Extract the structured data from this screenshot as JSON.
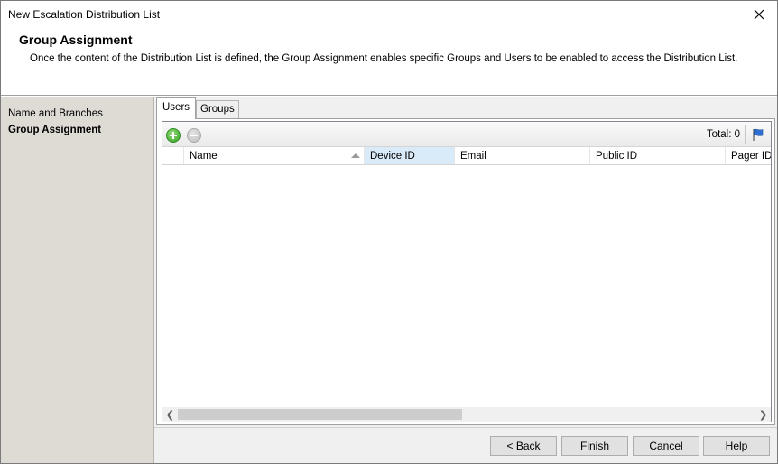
{
  "window": {
    "title": "New Escalation Distribution List"
  },
  "header": {
    "title": "Group Assignment",
    "description": "Once the content of the Distribution List is defined, the Group Assignment enables specific Groups and Users to be enabled to access the Distribution List."
  },
  "sidebar": {
    "items": [
      {
        "label": "Name and Branches",
        "active": false
      },
      {
        "label": "Group Assignment",
        "active": true
      }
    ]
  },
  "tabs": [
    {
      "label": "Users",
      "selected": true
    },
    {
      "label": "Groups",
      "selected": false
    }
  ],
  "toolbar": {
    "add_icon": "add-icon",
    "remove_icon": "remove-icon",
    "total_label": "Total: 0",
    "flag_icon": "flag-icon"
  },
  "grid": {
    "columns": [
      "Name",
      "Device ID",
      "Email",
      "Public ID",
      "Pager ID"
    ],
    "sorted_column": "Name",
    "highlighted_column": "Device ID",
    "rows": []
  },
  "buttons": {
    "back": "< Back",
    "finish": "Finish",
    "cancel": "Cancel",
    "help": "Help"
  },
  "colors": {
    "sidebar_bg": "#dedbd5",
    "content_bg": "#f0f0f0",
    "highlight_col": "#d9ebf9",
    "add_green": "#3aa32a",
    "flag_blue": "#2f6fd1"
  }
}
